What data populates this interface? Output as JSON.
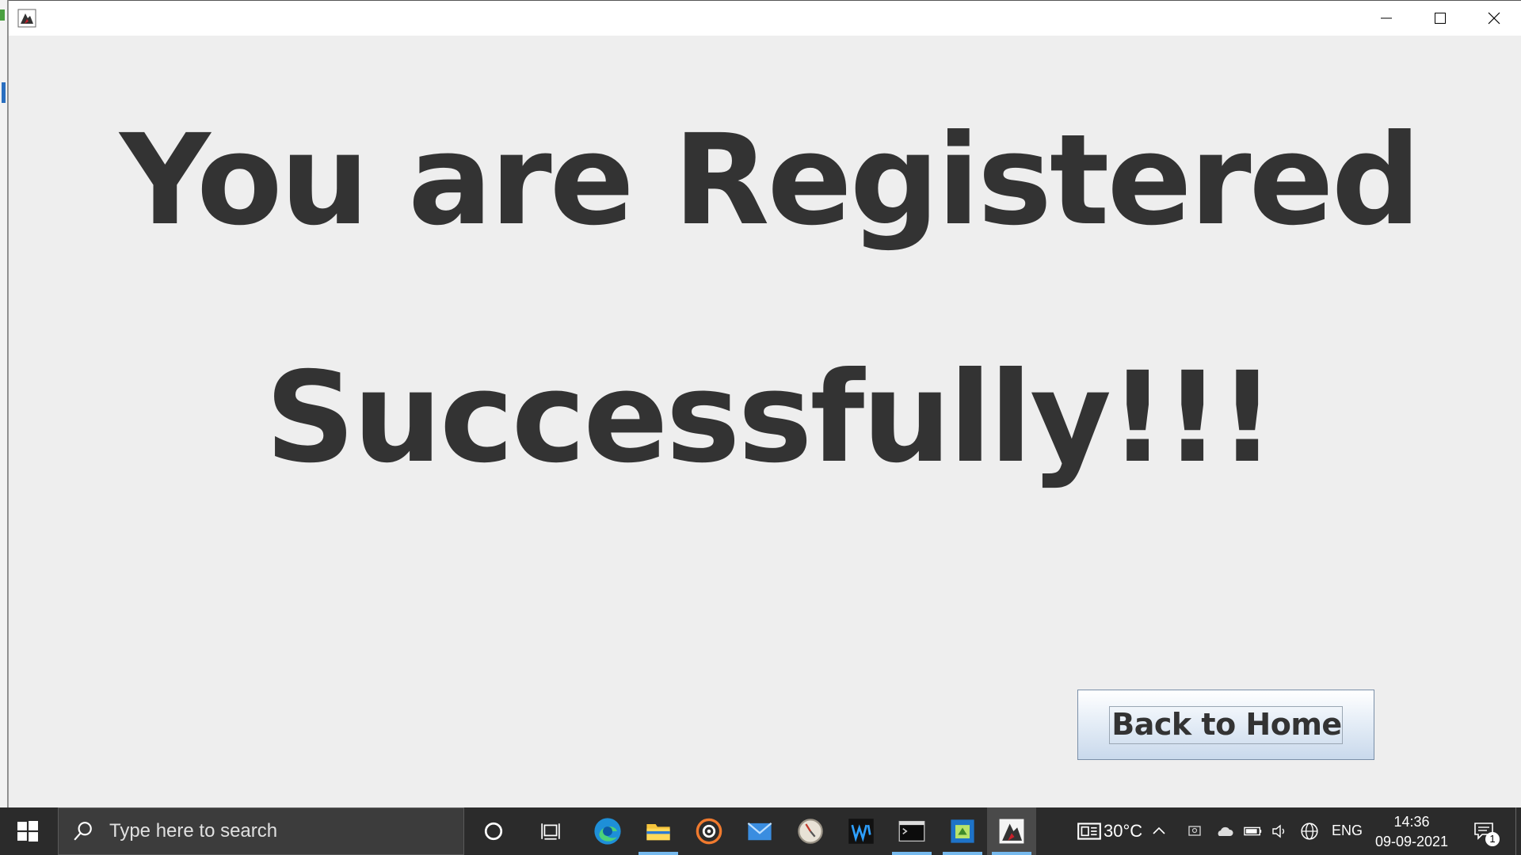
{
  "message": {
    "line1": "You are Registered",
    "line2": "Successfully!!!"
  },
  "home_button_label": "Back to Home",
  "taskbar": {
    "search_placeholder": "Type here to search",
    "weather": "30°C",
    "language": "ENG",
    "time": "14:36",
    "date": "09-09-2021",
    "notification_count": "1"
  },
  "colors": {
    "window_bg": "#eeeeee",
    "text": "#333333",
    "taskbar": "#2b2b2b",
    "accent": "#76b9ed"
  }
}
